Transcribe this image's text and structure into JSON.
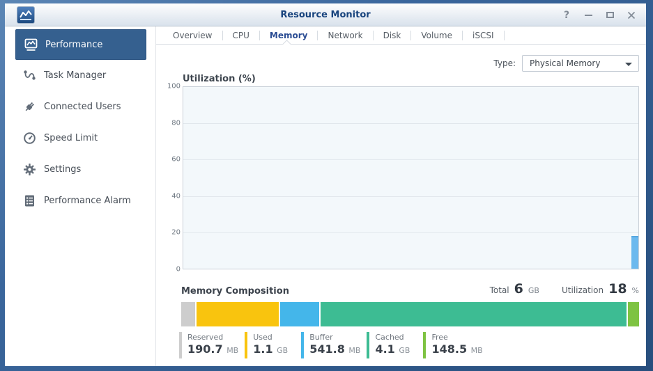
{
  "window": {
    "title": "Resource Monitor",
    "controls": {
      "help": "?",
      "minimize": "minimize",
      "maximize": "maximize",
      "close": "close"
    }
  },
  "sidebar": {
    "items": [
      {
        "label": "Performance",
        "icon": "performance-chart-icon",
        "selected": true
      },
      {
        "label": "Task Manager",
        "icon": "task-manager-icon",
        "selected": false
      },
      {
        "label": "Connected Users",
        "icon": "plug-icon",
        "selected": false
      },
      {
        "label": "Speed Limit",
        "icon": "speedometer-icon",
        "selected": false
      },
      {
        "label": "Settings",
        "icon": "gear-icon",
        "selected": false
      },
      {
        "label": "Performance Alarm",
        "icon": "alarm-list-icon",
        "selected": false
      }
    ]
  },
  "tabs": [
    {
      "label": "Overview",
      "selected": false
    },
    {
      "label": "CPU",
      "selected": false
    },
    {
      "label": "Memory",
      "selected": true
    },
    {
      "label": "Network",
      "selected": false
    },
    {
      "label": "Disk",
      "selected": false
    },
    {
      "label": "Volume",
      "selected": false
    },
    {
      "label": "iSCSI",
      "selected": false
    }
  ],
  "type_selector": {
    "label": "Type:",
    "value": "Physical Memory"
  },
  "chart_data": {
    "type": "area",
    "title": "Utilization (%)",
    "ylabel": "Utilization (%)",
    "ylim": [
      0,
      100
    ],
    "yticks_top_to_bottom": [
      "100",
      "80",
      "60",
      "40",
      "20",
      "0"
    ],
    "grid": true,
    "x_axis": "realtime, no labels visible; only latest sample drawn at right edge",
    "series": [
      {
        "name": "Memory Utilization (%)",
        "values": [
          18
        ]
      }
    ],
    "bar_color": "#6cb9ee"
  },
  "memory_composition": {
    "heading": "Memory Composition",
    "total": {
      "label": "Total",
      "value": "6",
      "unit": "GB"
    },
    "utilization": {
      "label": "Utilization",
      "value": "18",
      "unit": "%"
    },
    "total_mb": 6144,
    "segments": [
      {
        "label": "Reserved",
        "value": "190.7",
        "unit": "MB",
        "mb": 190.7,
        "color": "#cdcdcd"
      },
      {
        "label": "Used",
        "value": "1.1",
        "unit": "GB",
        "mb": 1126.4,
        "color": "#f9c40e"
      },
      {
        "label": "Buffer",
        "value": "541.8",
        "unit": "MB",
        "mb": 541.8,
        "color": "#44b6ea"
      },
      {
        "label": "Cached",
        "value": "4.1",
        "unit": "GB",
        "mb": 4198.4,
        "color": "#3dbc93"
      },
      {
        "label": "Free",
        "value": "148.5",
        "unit": "MB",
        "mb": 148.5,
        "color": "#7ec342"
      }
    ]
  }
}
